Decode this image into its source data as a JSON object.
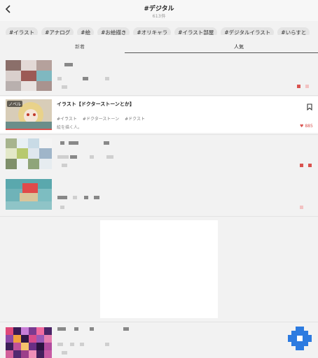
{
  "header": {
    "title": "#デジタル",
    "count": "613件",
    "back_icon": "chevron-left-icon"
  },
  "tags": [
    "#イラスト",
    "#アナログ",
    "#絵",
    "#お絵描き",
    "#オリキャラ",
    "#イラスト部屋",
    "#デジタルイラスト",
    "#いらすと"
  ],
  "tabs": {
    "new_label": "新着",
    "popular_label": "人気",
    "selected": "人気"
  },
  "novel": {
    "badge": "ノベル",
    "title": "イラスト【ドクターストーンとか】",
    "tags": [
      "#イラスト",
      "#ドクターストーン",
      "#ドクスト"
    ],
    "author": "絵を描く人。",
    "likes": "885",
    "bookmark_icon": "bookmark-icon",
    "like_icon": "heart-icon"
  },
  "colors": {
    "accent_red": "#d9534f",
    "fab_blue": "#2d7be0"
  }
}
